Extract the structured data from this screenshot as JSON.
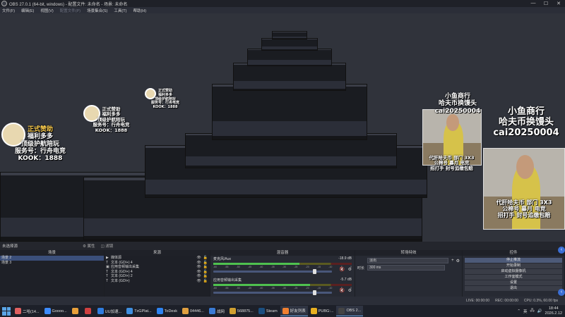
{
  "window": {
    "title": "OBS 27.0.1 (64-bit, windows) - 配置文件: 未命名 - 场景: 未命名",
    "min": "—",
    "max": "☐",
    "close": "✕"
  },
  "menubar": [
    "文件(F)",
    "编辑(E)",
    "视图(V)",
    "配置文件(P)",
    "场景集合(S)",
    "工具(T)",
    "帮助(H)"
  ],
  "overlay": {
    "sponsor_lines": [
      "正式赞助",
      "福利多多",
      "顶级护航陪玩",
      "服务号：行舟电竞",
      "KOOK：1888"
    ],
    "promo_lines": [
      "小鱼商行",
      "哈夫币换馒头",
      "cai20250004"
    ],
    "promo_lines2": [
      "代肝哈夫币 部门 3X3",
      "公棉号 暮月 电竞",
      "招打手 封号追缴包赔"
    ]
  },
  "studio_bar": {
    "info": "未选择源",
    "transition": "⚙ 属性",
    "filters": "◫ 滤镜"
  },
  "scenes": {
    "title": "场景",
    "items": [
      "场景 2",
      "场景 3"
    ],
    "footer": [
      "+",
      "−",
      "⌃",
      "⌄"
    ]
  },
  "sources": {
    "title": "来源",
    "items": [
      {
        "icon": "▶",
        "label": "媒体源"
      },
      {
        "icon": "T",
        "label": "文本 (GDI+) 4"
      },
      {
        "icon": "▣",
        "label": "应用音频输出采集"
      },
      {
        "icon": "T",
        "label": "文本 (GDI+) 4"
      },
      {
        "icon": "T",
        "label": "文本 (GDI+) 2"
      },
      {
        "icon": "T",
        "label": "文本 (GDI+)"
      }
    ],
    "footer": [
      "+",
      "−",
      "⚙",
      "⌃",
      "⌄"
    ]
  },
  "mixer": {
    "title": "混音器",
    "channels": [
      {
        "name": "麦克风/Aux",
        "db": "-18.9 dB",
        "level": 0.62,
        "volume": 0.86
      },
      {
        "name": "应用音频输出采集",
        "db": "-5.7 dB",
        "level": 0.7,
        "volume": 0.86
      }
    ],
    "scale": [
      "-60",
      "-55",
      "-50",
      "-45",
      "-40",
      "-35",
      "-30",
      "-25",
      "-20",
      "-15",
      "-10",
      "-5",
      "0"
    ]
  },
  "transitions": {
    "title": "转场特效",
    "type": "淡出",
    "duration_label": "时长",
    "duration": "300 ms"
  },
  "controls": {
    "title": "控件",
    "buttons": [
      "停止推流",
      "开始录制",
      "启动虚拟摄像机",
      "工作室模式",
      "设置",
      "退出"
    ]
  },
  "statusbar": {
    "live": "LIVE: 00:00:00",
    "rec": "REC: 00:00:00",
    "cpu": "CPU: 0.3%, 60.00 fps"
  },
  "taskbar": {
    "items": [
      {
        "label": "二哈(14...",
        "color": "#e06060"
      },
      {
        "label": "Goooo...",
        "color": "#3d8bfd"
      },
      {
        "label": "",
        "color": "#e8a03a"
      },
      {
        "label": "",
        "color": "#d04040"
      },
      {
        "label": "UU加速...",
        "color": "#2f7de0"
      },
      {
        "label": "TxGPlat...",
        "color": "#3f8fe0"
      },
      {
        "label": "ToDesk",
        "color": "#2e84f2"
      },
      {
        "label": "04446...",
        "color": "#e0a040"
      },
      {
        "label": "战网",
        "color": "#3a7bd5"
      },
      {
        "label": "568875...",
        "color": "#d0a030"
      },
      {
        "label": "Steam",
        "color": "#1b4f80"
      },
      {
        "label": "好友列表",
        "color": "#f08030",
        "active": true
      },
      {
        "label": "PUBG:...",
        "color": "#e8b020"
      },
      {
        "label": "OBS 2...",
        "color": "#444444",
        "active": true
      }
    ],
    "tray": "英",
    "time": "18:44",
    "date": "2026.2.12"
  }
}
